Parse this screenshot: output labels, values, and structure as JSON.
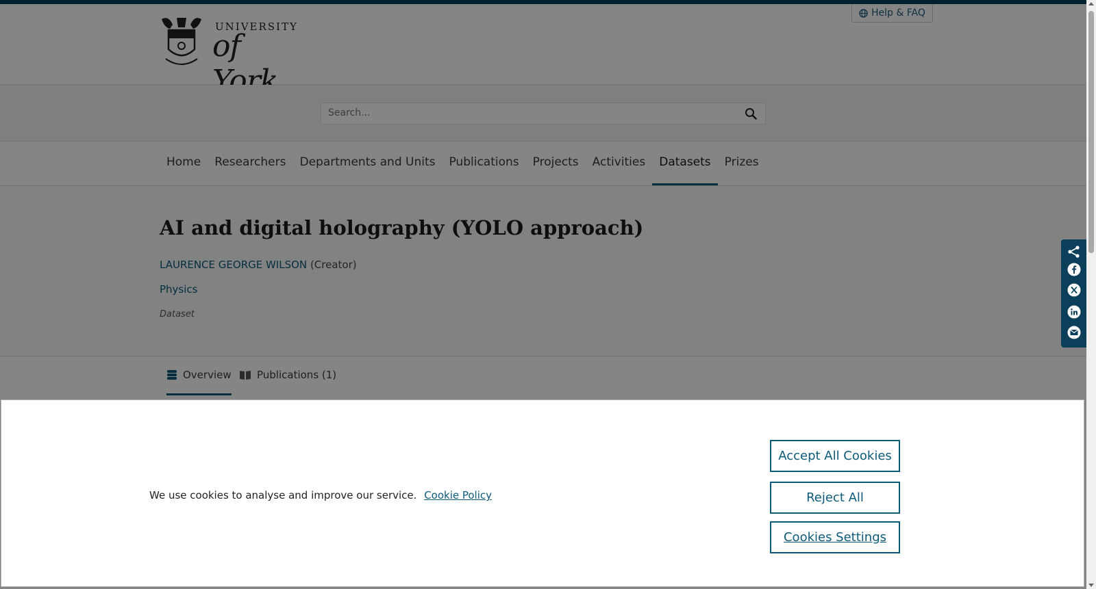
{
  "header": {
    "logo_line1": "UNIVERSITY",
    "logo_line2": "of York",
    "help_label": "Help & FAQ"
  },
  "search": {
    "placeholder": "Search..."
  },
  "nav": {
    "items": [
      {
        "label": "Home"
      },
      {
        "label": "Researchers"
      },
      {
        "label": "Departments and Units"
      },
      {
        "label": "Publications"
      },
      {
        "label": "Projects"
      },
      {
        "label": "Activities"
      },
      {
        "label": "Datasets",
        "active": true
      },
      {
        "label": "Prizes"
      }
    ]
  },
  "dataset": {
    "title": "AI and digital holography (YOLO approach)",
    "creator_name": "LAURENCE GEORGE WILSON",
    "creator_role": "(Creator)",
    "department": "Physics",
    "type": "Dataset"
  },
  "tabs": [
    {
      "label": "Overview",
      "active": true
    },
    {
      "label": "Publications (1)"
    }
  ],
  "cookie": {
    "message": "We use cookies to analyse and improve our service.",
    "policy_link": "Cookie Policy",
    "accept_label": "Accept All Cookies",
    "reject_label": "Reject All",
    "settings_label": "Cookies Settings"
  },
  "colors": {
    "brand": "#003f5c",
    "link": "#0b5a7a"
  }
}
